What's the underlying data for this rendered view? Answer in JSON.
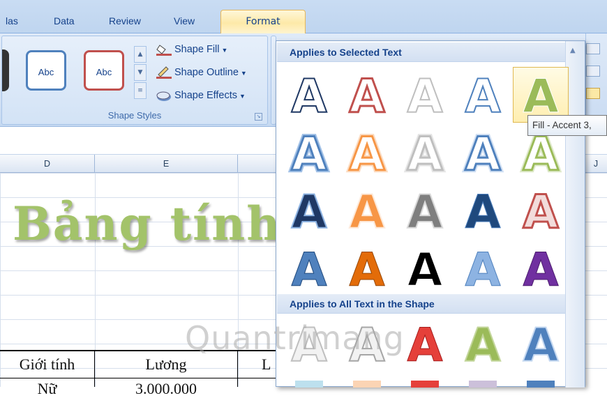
{
  "tabs": [
    {
      "label": "las",
      "active": false
    },
    {
      "label": "Data",
      "active": false
    },
    {
      "label": "Review",
      "active": false
    },
    {
      "label": "View",
      "active": false
    },
    {
      "label": "Format",
      "active": true
    }
  ],
  "ribbon": {
    "shape_styles": {
      "thumb_1": "Abc",
      "thumb_2": "Abc",
      "shape_fill": "Shape Fill",
      "shape_outline": "Shape Outline",
      "shape_effects": "Shape Effects",
      "group_label": "Shape Styles"
    }
  },
  "columns": [
    "D",
    "E",
    "J"
  ],
  "sheet": {
    "wordart_text": "Bảng tính",
    "header_cells": [
      "Giới tính",
      "Lương",
      "L"
    ],
    "partial_row": [
      "Nữ",
      "3.000.000"
    ]
  },
  "gallery": {
    "section_1": "Applies to Selected Text",
    "section_2": "Applies to All Text in the Shape",
    "letter": "A"
  },
  "tooltip": "Fill - Accent 3,",
  "watermark": "Quantrimang",
  "colors": {
    "ribbon_bg": "#d0e0f5",
    "active_tab": "#fde9a8",
    "wordart_green": "#a3c36a",
    "accent_red": "#c0504d",
    "accent_blue": "#4f81bd",
    "accent_orange": "#f79646",
    "accent_purple": "#7030a0"
  }
}
